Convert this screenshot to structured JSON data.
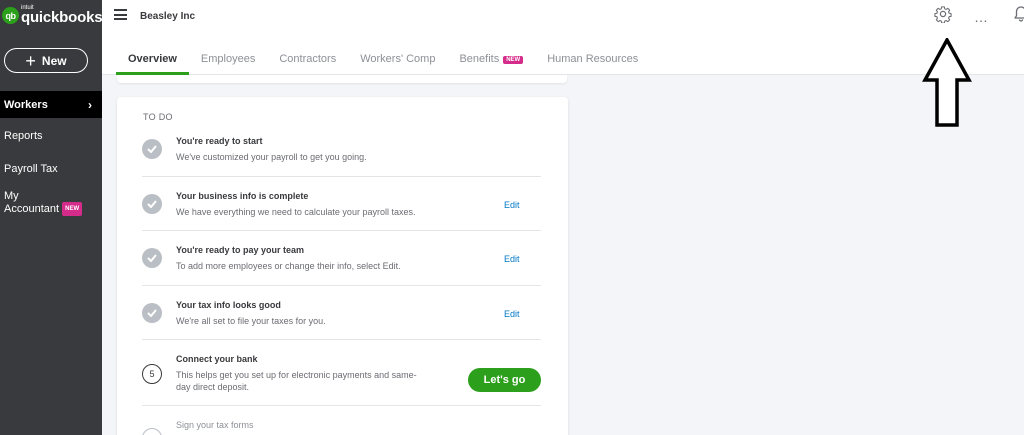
{
  "brand": {
    "intuit": "intuit",
    "name": "quickbooks",
    "logo_mark": "qb"
  },
  "sidebar": {
    "new_button": {
      "icon": "plus-icon",
      "label": "New"
    },
    "items": [
      {
        "label": "Workers",
        "active": true
      },
      {
        "label": "Reports"
      },
      {
        "label": "Payroll Tax"
      },
      {
        "label": "My Accountant",
        "line1": "My",
        "line2": "Accountant",
        "badge": "NEW"
      }
    ]
  },
  "header": {
    "company": "Beasley Inc",
    "icons": [
      "hamburger-icon",
      "gear-icon",
      "more-icon",
      "bell-icon"
    ]
  },
  "tabs": [
    {
      "label": "Overview",
      "active": true
    },
    {
      "label": "Employees"
    },
    {
      "label": "Contractors"
    },
    {
      "label": "Workers' Comp"
    },
    {
      "label": "Benefits",
      "badge": "NEW"
    },
    {
      "label": "Human Resources"
    }
  ],
  "todo": {
    "title": "TO DO",
    "items": [
      {
        "title": "You're ready to start",
        "desc": "We've customized your payroll to get you going.",
        "status": "done"
      },
      {
        "title": "Your business info is complete",
        "desc": "We have everything we need to calculate your payroll taxes.",
        "status": "done",
        "action": "Edit"
      },
      {
        "title": "You're ready to pay your team",
        "desc": "To add more employees or change their info, select Edit.",
        "status": "done",
        "action": "Edit"
      },
      {
        "title": "Your tax info looks good",
        "desc": "We're all set to file your taxes for you.",
        "status": "done",
        "action": "Edit"
      },
      {
        "step": "5",
        "title": "Connect your bank",
        "desc_line1": "This helps get you set up for electronic payments and same-",
        "desc_line2": "day direct deposit.",
        "action": "Let's go"
      },
      {
        "title": "Sign your tax forms"
      }
    ]
  },
  "colors": {
    "accent": "#2ca01c",
    "sidebar": "#393a3d",
    "link": "#0077c5",
    "badge": "#d52b8a"
  }
}
